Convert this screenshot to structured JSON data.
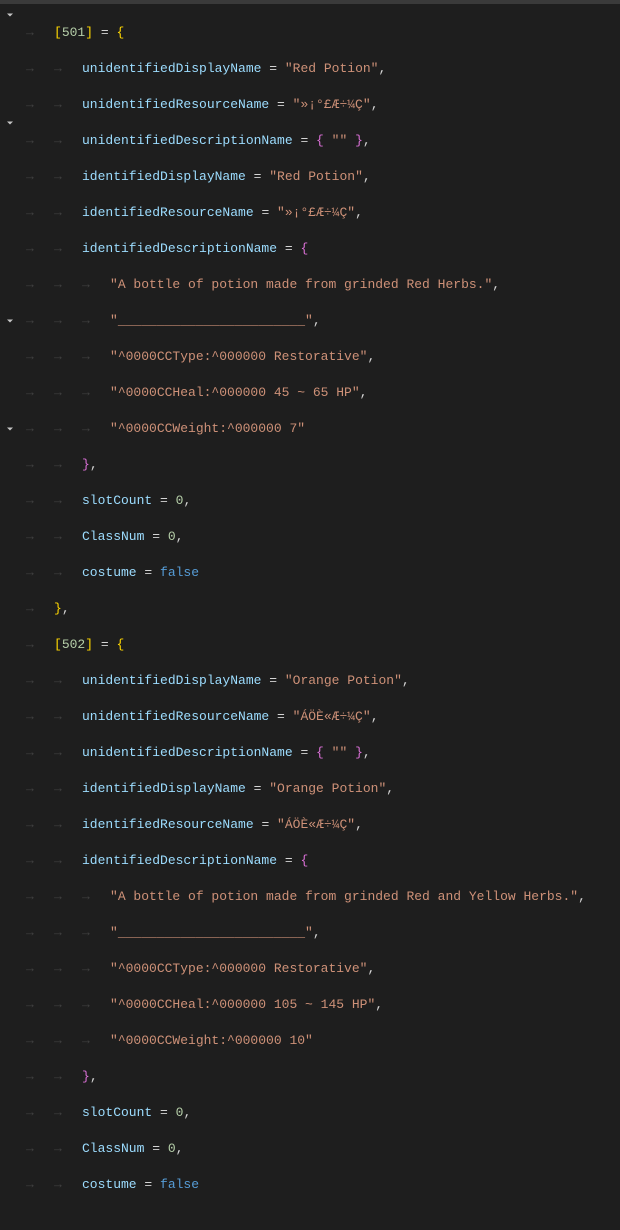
{
  "items": [
    {
      "id": "501",
      "unidentifiedDisplayName": "Red Potion",
      "unidentifiedResourceName": "»¡°£Æ÷¼Ç",
      "unidentifiedDescriptionName_empty": "\"\"",
      "identifiedDisplayName": "Red Potion",
      "identifiedResourceName": "»¡°£Æ÷¼Ç",
      "desc": [
        "A bottle of potion made from grinded Red Herbs.",
        "________________________",
        "^0000CCType:^000000 Restorative",
        "^0000CCHeal:^000000 45 ~ 65 HP",
        "^0000CCWeight:^000000 7"
      ],
      "slotCount": "0",
      "ClassNum": "0",
      "costume": "false"
    },
    {
      "id": "502",
      "unidentifiedDisplayName": "Orange Potion",
      "unidentifiedResourceName": "ÁÖÈ«Æ÷¼Ç",
      "unidentifiedDescriptionName_empty": "\"\"",
      "identifiedDisplayName": "Orange Potion",
      "identifiedResourceName": "ÁÖÈ«Æ÷¼Ç",
      "desc": [
        "A bottle of potion made from grinded Red and Yellow Herbs.",
        "________________________",
        "^0000CCType:^000000 Restorative",
        "^0000CCHeal:^000000 105 ~ 145 HP",
        "^0000CCWeight:^000000 10"
      ],
      "slotCount": "0",
      "ClassNum": "0",
      "costume": "false"
    }
  ],
  "labels": {
    "unidentifiedDisplayName": "unidentifiedDisplayName",
    "unidentifiedResourceName": "unidentifiedResourceName",
    "unidentifiedDescriptionName": "unidentifiedDescriptionName",
    "identifiedDisplayName": "identifiedDisplayName",
    "identifiedResourceName": "identifiedResourceName",
    "identifiedDescriptionName": "identifiedDescriptionName",
    "slotCount": "slotCount",
    "ClassNum": "ClassNum",
    "costume": "costume"
  }
}
